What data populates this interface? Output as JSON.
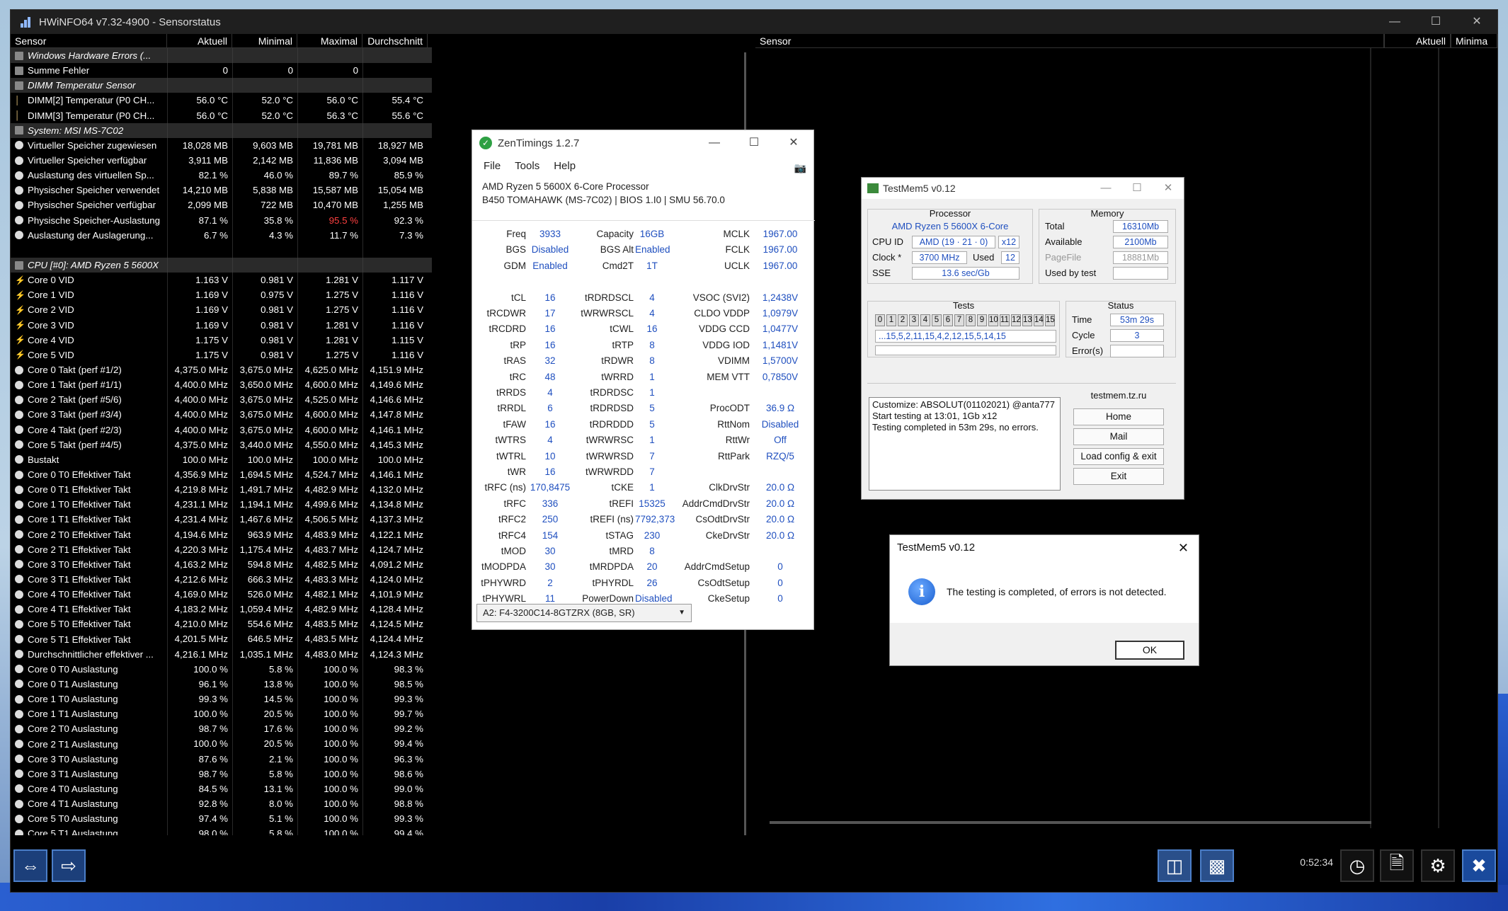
{
  "hwinfo": {
    "title": "HWiNFO64 v7.32-4900 - Sensorstatus",
    "columns": [
      "Sensor",
      "Aktuell",
      "Minimal",
      "Maximal",
      "Durchschnitt"
    ],
    "right_columns": [
      "Sensor",
      "Aktuell",
      "Minima"
    ],
    "timer": "0:52:34",
    "rows": [
      {
        "type": "group",
        "name": "Windows Hardware Errors (...",
        "cur": "",
        "min": "",
        "max": "",
        "avg": ""
      },
      {
        "type": "data",
        "icon": "sq",
        "name": "Summe Fehler",
        "cur": "0",
        "min": "0",
        "max": "0",
        "avg": ""
      },
      {
        "type": "group",
        "name": "DIMM Temperatur Sensor",
        "cur": "",
        "min": "",
        "max": "",
        "avg": ""
      },
      {
        "type": "data",
        "icon": "therm",
        "name": "DIMM[2] Temperatur (P0 CH...",
        "cur": "56.0 °C",
        "min": "52.0 °C",
        "max": "56.0 °C",
        "avg": "55.4 °C"
      },
      {
        "type": "data",
        "icon": "therm",
        "name": "DIMM[3] Temperatur (P0 CH...",
        "cur": "56.0 °C",
        "min": "52.0 °C",
        "max": "56.3 °C",
        "avg": "55.6 °C"
      },
      {
        "type": "group",
        "name": "System: MSI MS-7C02",
        "cur": "",
        "min": "",
        "max": "",
        "avg": ""
      },
      {
        "type": "data",
        "icon": "dot",
        "name": "Virtueller Speicher zugewiesen",
        "cur": "18,028 MB",
        "min": "9,603 MB",
        "max": "19,781 MB",
        "avg": "18,927 MB"
      },
      {
        "type": "data",
        "icon": "dot",
        "name": "Virtueller Speicher verfügbar",
        "cur": "3,911 MB",
        "min": "2,142 MB",
        "max": "11,836 MB",
        "avg": "3,094 MB"
      },
      {
        "type": "data",
        "icon": "dot",
        "name": "Auslastung des virtuellen Sp...",
        "cur": "82.1 %",
        "min": "46.0 %",
        "max": "89.7 %",
        "avg": "85.9 %"
      },
      {
        "type": "data",
        "icon": "dot",
        "name": "Physischer Speicher verwendet",
        "cur": "14,210 MB",
        "min": "5,838 MB",
        "max": "15,587 MB",
        "avg": "15,054 MB"
      },
      {
        "type": "data",
        "icon": "dot",
        "name": "Physischer Speicher verfügbar",
        "cur": "2,099 MB",
        "min": "722 MB",
        "max": "10,470 MB",
        "avg": "1,255 MB"
      },
      {
        "type": "data",
        "icon": "dot",
        "name": "Physische Speicher-Auslastung",
        "cur": "87.1 %",
        "min": "35.8 %",
        "max": "95.5 %",
        "avg": "92.3 %",
        "maxred": true
      },
      {
        "type": "data",
        "icon": "dot",
        "name": "Auslastung der Auslagerung...",
        "cur": "6.7 %",
        "min": "4.3 %",
        "max": "11.7 %",
        "avg": "7.3 %"
      },
      {
        "type": "blank",
        "name": "",
        "cur": "",
        "min": "",
        "max": "",
        "avg": ""
      },
      {
        "type": "group",
        "name": "CPU [#0]: AMD Ryzen 5 5600X",
        "cur": "",
        "min": "",
        "max": "",
        "avg": ""
      },
      {
        "type": "data",
        "icon": "bolt",
        "name": "Core 0 VID",
        "cur": "1.163 V",
        "min": "0.981 V",
        "max": "1.281 V",
        "avg": "1.117 V"
      },
      {
        "type": "data",
        "icon": "bolt",
        "name": "Core 1 VID",
        "cur": "1.169 V",
        "min": "0.975 V",
        "max": "1.275 V",
        "avg": "1.116 V"
      },
      {
        "type": "data",
        "icon": "bolt",
        "name": "Core 2 VID",
        "cur": "1.169 V",
        "min": "0.981 V",
        "max": "1.275 V",
        "avg": "1.116 V"
      },
      {
        "type": "data",
        "icon": "bolt",
        "name": "Core 3 VID",
        "cur": "1.169 V",
        "min": "0.981 V",
        "max": "1.281 V",
        "avg": "1.116 V"
      },
      {
        "type": "data",
        "icon": "bolt",
        "name": "Core 4 VID",
        "cur": "1.175 V",
        "min": "0.981 V",
        "max": "1.281 V",
        "avg": "1.115 V"
      },
      {
        "type": "data",
        "icon": "bolt",
        "name": "Core 5 VID",
        "cur": "1.175 V",
        "min": "0.981 V",
        "max": "1.275 V",
        "avg": "1.116 V"
      },
      {
        "type": "data",
        "icon": "dot",
        "name": "Core 0 Takt (perf #1/2)",
        "cur": "4,375.0 MHz",
        "min": "3,675.0 MHz",
        "max": "4,625.0 MHz",
        "avg": "4,151.9 MHz"
      },
      {
        "type": "data",
        "icon": "dot",
        "name": "Core 1 Takt (perf #1/1)",
        "cur": "4,400.0 MHz",
        "min": "3,650.0 MHz",
        "max": "4,600.0 MHz",
        "avg": "4,149.6 MHz"
      },
      {
        "type": "data",
        "icon": "dot",
        "name": "Core 2 Takt (perf #5/6)",
        "cur": "4,400.0 MHz",
        "min": "3,675.0 MHz",
        "max": "4,525.0 MHz",
        "avg": "4,146.6 MHz"
      },
      {
        "type": "data",
        "icon": "dot",
        "name": "Core 3 Takt (perf #3/4)",
        "cur": "4,400.0 MHz",
        "min": "3,675.0 MHz",
        "max": "4,600.0 MHz",
        "avg": "4,147.8 MHz"
      },
      {
        "type": "data",
        "icon": "dot",
        "name": "Core 4 Takt (perf #2/3)",
        "cur": "4,400.0 MHz",
        "min": "3,675.0 MHz",
        "max": "4,600.0 MHz",
        "avg": "4,146.1 MHz"
      },
      {
        "type": "data",
        "icon": "dot",
        "name": "Core 5 Takt (perf #4/5)",
        "cur": "4,375.0 MHz",
        "min": "3,440.0 MHz",
        "max": "4,550.0 MHz",
        "avg": "4,145.3 MHz"
      },
      {
        "type": "data",
        "icon": "dot",
        "name": "Bustakt",
        "cur": "100.0 MHz",
        "min": "100.0 MHz",
        "max": "100.0 MHz",
        "avg": "100.0 MHz"
      },
      {
        "type": "data",
        "icon": "dot",
        "name": "Core 0 T0 Effektiver Takt",
        "cur": "4,356.9 MHz",
        "min": "1,694.5 MHz",
        "max": "4,524.7 MHz",
        "avg": "4,146.1 MHz"
      },
      {
        "type": "data",
        "icon": "dot",
        "name": "Core 0 T1 Effektiver Takt",
        "cur": "4,219.8 MHz",
        "min": "1,491.7 MHz",
        "max": "4,482.9 MHz",
        "avg": "4,132.0 MHz"
      },
      {
        "type": "data",
        "icon": "dot",
        "name": "Core 1 T0 Effektiver Takt",
        "cur": "4,231.1 MHz",
        "min": "1,194.1 MHz",
        "max": "4,499.6 MHz",
        "avg": "4,134.8 MHz"
      },
      {
        "type": "data",
        "icon": "dot",
        "name": "Core 1 T1 Effektiver Takt",
        "cur": "4,231.4 MHz",
        "min": "1,467.6 MHz",
        "max": "4,506.5 MHz",
        "avg": "4,137.3 MHz"
      },
      {
        "type": "data",
        "icon": "dot",
        "name": "Core 2 T0 Effektiver Takt",
        "cur": "4,194.6 MHz",
        "min": "963.9 MHz",
        "max": "4,483.9 MHz",
        "avg": "4,122.1 MHz"
      },
      {
        "type": "data",
        "icon": "dot",
        "name": "Core 2 T1 Effektiver Takt",
        "cur": "4,220.3 MHz",
        "min": "1,175.4 MHz",
        "max": "4,483.7 MHz",
        "avg": "4,124.7 MHz"
      },
      {
        "type": "data",
        "icon": "dot",
        "name": "Core 3 T0 Effektiver Takt",
        "cur": "4,163.2 MHz",
        "min": "594.8 MHz",
        "max": "4,482.5 MHz",
        "avg": "4,091.2 MHz"
      },
      {
        "type": "data",
        "icon": "dot",
        "name": "Core 3 T1 Effektiver Takt",
        "cur": "4,212.6 MHz",
        "min": "666.3 MHz",
        "max": "4,483.3 MHz",
        "avg": "4,124.0 MHz"
      },
      {
        "type": "data",
        "icon": "dot",
        "name": "Core 4 T0 Effektiver Takt",
        "cur": "4,169.0 MHz",
        "min": "526.0 MHz",
        "max": "4,482.1 MHz",
        "avg": "4,101.9 MHz"
      },
      {
        "type": "data",
        "icon": "dot",
        "name": "Core 4 T1 Effektiver Takt",
        "cur": "4,183.2 MHz",
        "min": "1,059.4 MHz",
        "max": "4,482.9 MHz",
        "avg": "4,128.4 MHz"
      },
      {
        "type": "data",
        "icon": "dot",
        "name": "Core 5 T0 Effektiver Takt",
        "cur": "4,210.0 MHz",
        "min": "554.6 MHz",
        "max": "4,483.5 MHz",
        "avg": "4,124.5 MHz"
      },
      {
        "type": "data",
        "icon": "dot",
        "name": "Core 5 T1 Effektiver Takt",
        "cur": "4,201.5 MHz",
        "min": "646.5 MHz",
        "max": "4,483.5 MHz",
        "avg": "4,124.4 MHz"
      },
      {
        "type": "data",
        "icon": "dot",
        "name": "Durchschnittlicher effektiver ...",
        "cur": "4,216.1 MHz",
        "min": "1,035.1 MHz",
        "max": "4,483.0 MHz",
        "avg": "4,124.3 MHz"
      },
      {
        "type": "data",
        "icon": "dot",
        "name": "Core 0 T0 Auslastung",
        "cur": "100.0 %",
        "min": "5.8 %",
        "max": "100.0 %",
        "avg": "98.3 %"
      },
      {
        "type": "data",
        "icon": "dot",
        "name": "Core 0 T1 Auslastung",
        "cur": "96.1 %",
        "min": "13.8 %",
        "max": "100.0 %",
        "avg": "98.5 %"
      },
      {
        "type": "data",
        "icon": "dot",
        "name": "Core 1 T0 Auslastung",
        "cur": "99.3 %",
        "min": "14.5 %",
        "max": "100.0 %",
        "avg": "99.3 %"
      },
      {
        "type": "data",
        "icon": "dot",
        "name": "Core 1 T1 Auslastung",
        "cur": "100.0 %",
        "min": "20.5 %",
        "max": "100.0 %",
        "avg": "99.7 %"
      },
      {
        "type": "data",
        "icon": "dot",
        "name": "Core 2 T0 Auslastung",
        "cur": "98.7 %",
        "min": "17.6 %",
        "max": "100.0 %",
        "avg": "99.2 %"
      },
      {
        "type": "data",
        "icon": "dot",
        "name": "Core 2 T1 Auslastung",
        "cur": "100.0 %",
        "min": "20.5 %",
        "max": "100.0 %",
        "avg": "99.4 %"
      },
      {
        "type": "data",
        "icon": "dot",
        "name": "Core 3 T0 Auslastung",
        "cur": "87.6 %",
        "min": "2.1 %",
        "max": "100.0 %",
        "avg": "96.3 %"
      },
      {
        "type": "data",
        "icon": "dot",
        "name": "Core 3 T1 Auslastung",
        "cur": "98.7 %",
        "min": "5.8 %",
        "max": "100.0 %",
        "avg": "98.6 %"
      },
      {
        "type": "data",
        "icon": "dot",
        "name": "Core 4 T0 Auslastung",
        "cur": "84.5 %",
        "min": "13.1 %",
        "max": "100.0 %",
        "avg": "99.0 %"
      },
      {
        "type": "data",
        "icon": "dot",
        "name": "Core 4 T1 Auslastung",
        "cur": "92.8 %",
        "min": "8.0 %",
        "max": "100.0 %",
        "avg": "98.8 %"
      },
      {
        "type": "data",
        "icon": "dot",
        "name": "Core 5 T0 Auslastung",
        "cur": "97.4 %",
        "min": "5.1 %",
        "max": "100.0 %",
        "avg": "99.3 %"
      },
      {
        "type": "data",
        "icon": "dot",
        "name": "Core 5 T1 Auslastung",
        "cur": "98.0 %",
        "min": "5.8 %",
        "max": "100.0 %",
        "avg": "99.4 %"
      }
    ]
  },
  "zen": {
    "title": "ZenTimings 1.2.7",
    "menu": [
      "File",
      "Tools",
      "Help"
    ],
    "cpu_line1": "AMD Ryzen 5 5600X 6-Core Processor",
    "cpu_line2": "B450 TOMAHAWK (MS-7C02) | BIOS 1.I0 | SMU 56.70.0",
    "rows": [
      [
        "Freq",
        "3933",
        "Capacity",
        "16GB",
        "MCLK",
        "1967.00"
      ],
      [
        "BGS",
        "Disabled",
        "BGS Alt",
        "Enabled",
        "FCLK",
        "1967.00"
      ],
      [
        "GDM",
        "Enabled",
        "Cmd2T",
        "1T",
        "UCLK",
        "1967.00"
      ],
      [
        "",
        "",
        "",
        "",
        "",
        ""
      ],
      [
        "tCL",
        "16",
        "tRDRDSCL",
        "4",
        "VSOC (SVI2)",
        "1,2438V"
      ],
      [
        "tRCDWR",
        "17",
        "tWRWRSCL",
        "4",
        "CLDO VDDP",
        "1,0979V"
      ],
      [
        "tRCDRD",
        "16",
        "tCWL",
        "16",
        "VDDG CCD",
        "1,0477V"
      ],
      [
        "tRP",
        "16",
        "tRTP",
        "8",
        "VDDG IOD",
        "1,1481V"
      ],
      [
        "tRAS",
        "32",
        "tRDWR",
        "8",
        "VDIMM",
        "1,5700V"
      ],
      [
        "tRC",
        "48",
        "tWRRD",
        "1",
        "MEM VTT",
        "0,7850V"
      ],
      [
        "tRRDS",
        "4",
        "tRDRDSC",
        "1",
        "",
        ""
      ],
      [
        "tRRDL",
        "6",
        "tRDRDSD",
        "5",
        "ProcODT",
        "36.9 Ω"
      ],
      [
        "tFAW",
        "16",
        "tRDRDDD",
        "5",
        "RttNom",
        "Disabled"
      ],
      [
        "tWTRS",
        "4",
        "tWRWRSC",
        "1",
        "RttWr",
        "Off"
      ],
      [
        "tWTRL",
        "10",
        "tWRWRSD",
        "7",
        "RttPark",
        "RZQ/5"
      ],
      [
        "tWR",
        "16",
        "tWRWRDD",
        "7",
        "",
        ""
      ],
      [
        "tRFC (ns)",
        "170,8475",
        "tCKE",
        "1",
        "ClkDrvStr",
        "20.0 Ω"
      ],
      [
        "tRFC",
        "336",
        "tREFI",
        "15325",
        "AddrCmdDrvStr",
        "20.0 Ω"
      ],
      [
        "tRFC2",
        "250",
        "tREFI (ns)",
        "7792,373",
        "CsOdtDrvStr",
        "20.0 Ω"
      ],
      [
        "tRFC4",
        "154",
        "tSTAG",
        "230",
        "CkeDrvStr",
        "20.0 Ω"
      ],
      [
        "tMOD",
        "30",
        "tMRD",
        "8",
        "",
        ""
      ],
      [
        "tMODPDA",
        "30",
        "tMRDPDA",
        "20",
        "AddrCmdSetup",
        "0"
      ],
      [
        "tPHYWRD",
        "2",
        "tPHYRDL",
        "26",
        "CsOdtSetup",
        "0"
      ],
      [
        "tPHYWRL",
        "11",
        "PowerDown",
        "Disabled",
        "CkeSetup",
        "0"
      ]
    ],
    "module": "A2: F4-3200C14-8GTZRX (8GB, SR)"
  },
  "tm": {
    "title": "TestMem5 v0.12",
    "processor_hd": "Processor",
    "processor_name": "AMD Ryzen 5 5600X 6-Core",
    "cpuid_lbl": "CPU ID",
    "cpuid": "AMD  (19 · 21 · 0)",
    "threads": "x12",
    "clock_lbl": "Clock *",
    "clock": "3700 MHz",
    "used_lbl": "Used",
    "used": "12",
    "sse_lbl": "SSE",
    "sse": "13.6 sec/Gb",
    "memory_hd": "Memory",
    "total_lbl": "Total",
    "total": "16310Mb",
    "avail_lbl": "Available",
    "avail": "2100Mb",
    "pagefile_lbl": "PageFile",
    "pagefile": "18881Mb",
    "usedby_lbl": "Used by test",
    "tests_hd": "Tests",
    "test_nums": [
      "0",
      "1",
      "2",
      "3",
      "4",
      "5",
      "6",
      "7",
      "8",
      "9",
      "10",
      "11",
      "12",
      "13",
      "14",
      "15"
    ],
    "sequence": "...15,5,2,11,15,4,2,12,15,5,14,15",
    "status_hd": "Status",
    "time_lbl": "Time",
    "time": "53m 29s",
    "cycle_lbl": "Cycle",
    "cycle": "3",
    "errors_lbl": "Error(s)",
    "log": [
      "Customize: ABSOLUT(01102021) @anta777",
      "Start testing at 13:01, 1Gb x12",
      "Testing completed in 53m 29s, no errors."
    ],
    "site": "testmem.tz.ru",
    "btn_home": "Home",
    "btn_mail": "Mail",
    "btn_load": "Load config & exit",
    "btn_exit": "Exit"
  },
  "dialog": {
    "title": "TestMem5 v0.12",
    "message": "The testing is completed, of errors is not detected.",
    "ok": "OK"
  }
}
